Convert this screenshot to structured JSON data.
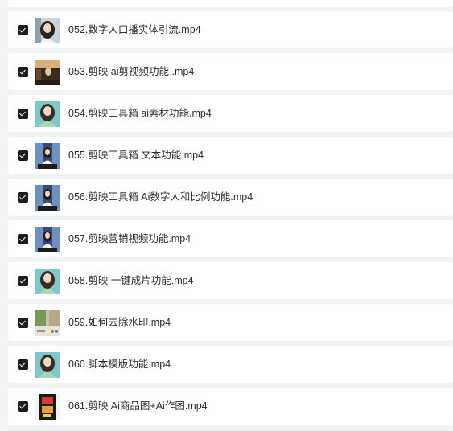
{
  "files": [
    {
      "name": "052.数字人口播实体引流.mp4",
      "checked": true,
      "thumbnail": "woman-portrait"
    },
    {
      "name": "053.剪映 ai剪视频功能 .mp4",
      "checked": true,
      "thumbnail": "office-man"
    },
    {
      "name": "054.剪映工具箱 ai素材功能.mp4",
      "checked": true,
      "thumbnail": "avatar-teal"
    },
    {
      "name": "055.剪映工具箱 文本功能.mp4",
      "checked": true,
      "thumbnail": "avatar-studio"
    },
    {
      "name": "056.剪映工具箱 Ai数字人和比例功能.mp4",
      "checked": true,
      "thumbnail": "avatar-studio"
    },
    {
      "name": "057.剪映营销视频功能.mp4",
      "checked": true,
      "thumbnail": "avatar-studio"
    },
    {
      "name": "058.剪映 一键成片功能.mp4",
      "checked": true,
      "thumbnail": "avatar-teal"
    },
    {
      "name": "059.如何去除水印.mp4",
      "checked": true,
      "thumbnail": "street-scene"
    },
    {
      "name": "060.脚本模版功能.mp4",
      "checked": true,
      "thumbnail": "avatar-teal"
    },
    {
      "name": "061.剪映 Ai商品图+Ai作图.mp4",
      "checked": true,
      "thumbnail": "product-poster"
    }
  ],
  "colors": {
    "background": "#f2f3f5",
    "row": "#ffffff",
    "checkbox": "#1d1d1f",
    "text": "#2b2d33"
  }
}
